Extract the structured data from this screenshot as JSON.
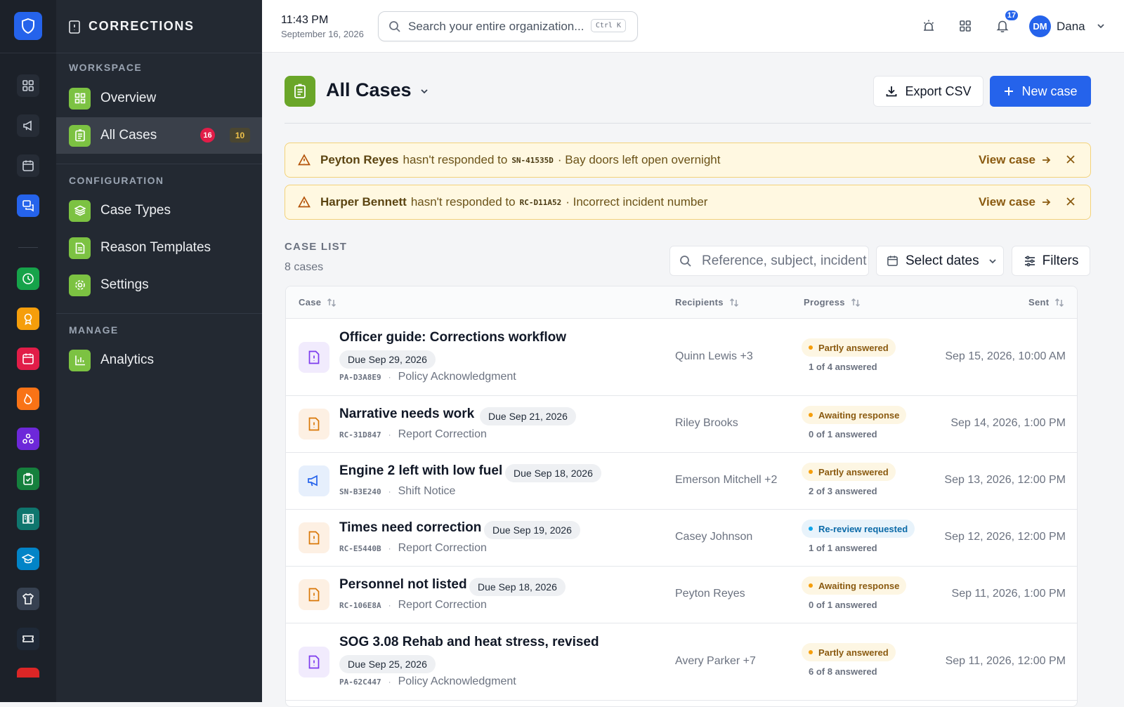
{
  "app": {
    "section_title": "CORRECTIONS"
  },
  "colors": {
    "accent": "#2563eb",
    "green": "#7cc242",
    "warning_bg": "#fff8e1",
    "danger": "#e11d48"
  },
  "rail": {
    "icons": [
      "dashboard-icon",
      "megaphone-icon",
      "calendar-icon",
      "chat-icon",
      "clock-icon",
      "award-icon",
      "calendar-red-icon",
      "flame-icon",
      "network-icon",
      "clipboard-check-icon",
      "book-icon",
      "graduation-cap-icon",
      "shirt-icon",
      "ticket-icon",
      "alert-icon"
    ]
  },
  "sidebar": {
    "workspace_label": "WORKSPACE",
    "config_label": "CONFIGURATION",
    "manage_label": "MANAGE",
    "items": {
      "overview": "Overview",
      "all_cases": "All Cases",
      "case_types": "Case Types",
      "reason_templates": "Reason Templates",
      "settings": "Settings",
      "analytics": "Analytics"
    },
    "all_cases_badge_red": "16",
    "all_cases_badge_amber": "10"
  },
  "topbar": {
    "time": "11:43 PM",
    "date": "September 16, 2026",
    "search_placeholder": "Search your entire organization...",
    "search_shortcut": "Ctrl K",
    "notification_count": "17",
    "user_initials": "DM",
    "user_name": "Dana"
  },
  "page": {
    "title": "All Cases",
    "export_label": "Export CSV",
    "new_case_label": "New case"
  },
  "alerts": [
    {
      "name": "Peyton Reyes",
      "text": "hasn't responded to",
      "code": "SN-41535D",
      "subject": "· Bay doors left open overnight",
      "link": "View case"
    },
    {
      "name": "Harper Bennett",
      "text": "hasn't responded to",
      "code": "RC-D11A52",
      "subject": "· Incorrect incident number",
      "link": "View case"
    }
  ],
  "case_list": {
    "heading": "CASE LIST",
    "count": "8 cases",
    "search_placeholder": "Reference, subject, incident",
    "dates_label": "Select dates",
    "filters_label": "Filters",
    "columns": {
      "case": "Case",
      "recipients": "Recipients",
      "progress": "Progress",
      "sent": "Sent"
    },
    "rows": [
      {
        "title": "Officer guide: Corrections workflow",
        "due": "Due Sep 29, 2026",
        "ref": "PA-D3A8E9",
        "type": "Policy Acknowledgment",
        "recipients": "Quinn Lewis +3",
        "status": "Partly answered",
        "answered": "1 of 4 answered",
        "sent": "Sep 15, 2026, 10:00 AM"
      },
      {
        "title": "Narrative needs work",
        "due": "Due Sep 21, 2026",
        "ref": "RC-31D847",
        "type": "Report Correction",
        "recipients": "Riley Brooks",
        "status": "Awaiting response",
        "answered": "0 of 1 answered",
        "sent": "Sep 14, 2026, 1:00 PM"
      },
      {
        "title": "Engine 2 left with low fuel",
        "due": "Due Sep 18, 2026",
        "ref": "SN-B3E240",
        "type": "Shift Notice",
        "recipients": "Emerson Mitchell +2",
        "status": "Partly answered",
        "answered": "2 of 3 answered",
        "sent": "Sep 13, 2026, 12:00 PM"
      },
      {
        "title": "Times need correction",
        "due": "Due Sep 19, 2026",
        "ref": "RC-E5440B",
        "type": "Report Correction",
        "recipients": "Casey Johnson",
        "status": "Re-review requested",
        "answered": "1 of 1 answered",
        "sent": "Sep 12, 2026, 12:00 PM"
      },
      {
        "title": "Personnel not listed",
        "due": "Due Sep 18, 2026",
        "ref": "RC-106E8A",
        "type": "Report Correction",
        "recipients": "Peyton Reyes",
        "status": "Awaiting response",
        "answered": "0 of 1 answered",
        "sent": "Sep 11, 2026, 1:00 PM"
      },
      {
        "title": "SOG 3.08 Rehab and heat stress, revised",
        "due": "Due Sep 25, 2026",
        "ref": "PA-62C447",
        "type": "Policy Acknowledgment",
        "recipients": "Avery Parker +7",
        "status": "Partly answered",
        "answered": "6 of 8 answered",
        "sent": "Sep 11, 2026, 12:00 PM"
      }
    ]
  }
}
